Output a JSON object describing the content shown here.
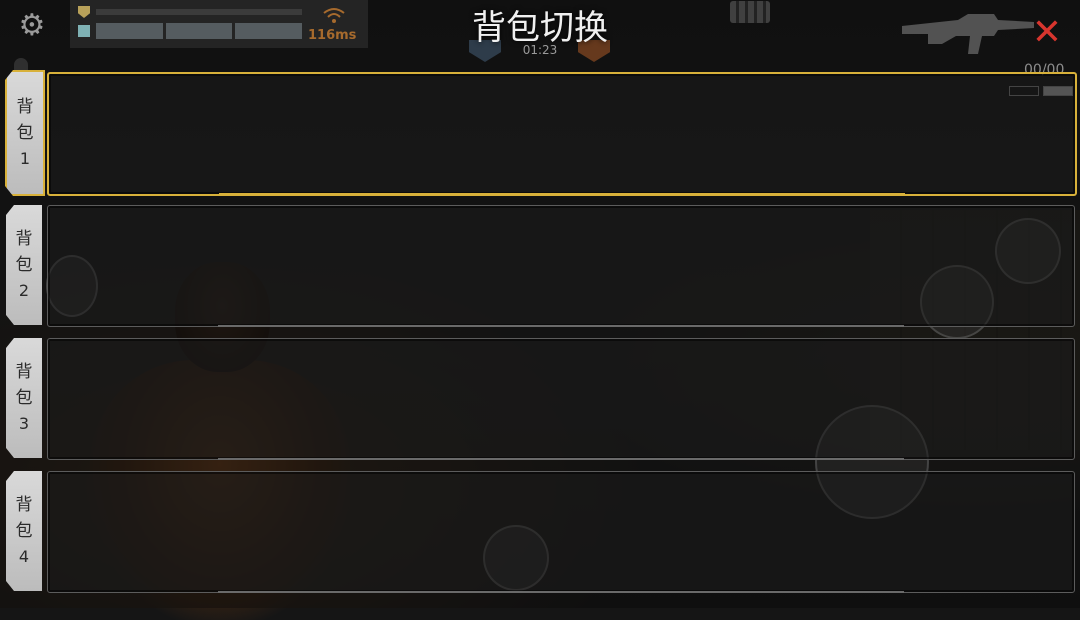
{
  "header": {
    "title": "背包切换",
    "timer": "01:23",
    "ping": "116ms"
  },
  "weapon": {
    "ammo": "00/00"
  },
  "backpacks": [
    {
      "label_top": "背",
      "label_mid": "包",
      "label_num": "1",
      "selected": true
    },
    {
      "label_top": "背",
      "label_mid": "包",
      "label_num": "2",
      "selected": false
    },
    {
      "label_top": "背",
      "label_mid": "包",
      "label_num": "3",
      "selected": false
    },
    {
      "label_top": "背",
      "label_mid": "包",
      "label_num": "4",
      "selected": false
    }
  ],
  "icons": {
    "settings": "gear-icon",
    "close": "close-icon",
    "wifi": "wifi-icon",
    "weapon": "rifle-icon",
    "keyboard": "keyboard-icon",
    "jump": "jump-icon",
    "reload": "bullet-icon",
    "fire": "crosshair-icon",
    "sprint": "run-icon",
    "bag": "backpack-icon"
  },
  "colors": {
    "selection_gold": "#d8b13a",
    "close_red": "#d8352e",
    "ping_orange": "#a66a2d",
    "tab_light": "#d9d9d9"
  }
}
